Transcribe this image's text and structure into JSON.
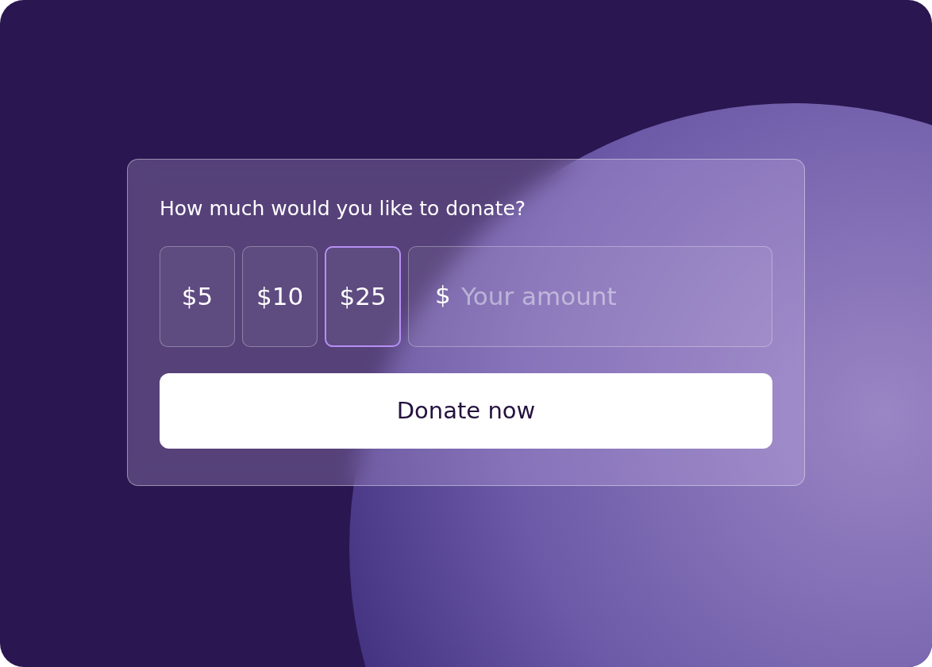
{
  "card": {
    "title": "How much would you like to donate?",
    "amounts": [
      {
        "label": "$5",
        "selected": false
      },
      {
        "label": "$10",
        "selected": false
      },
      {
        "label": "$25",
        "selected": true
      }
    ],
    "custom_amount": {
      "prefix": "$",
      "placeholder": "Your amount"
    },
    "submit_button": "Donate now"
  }
}
